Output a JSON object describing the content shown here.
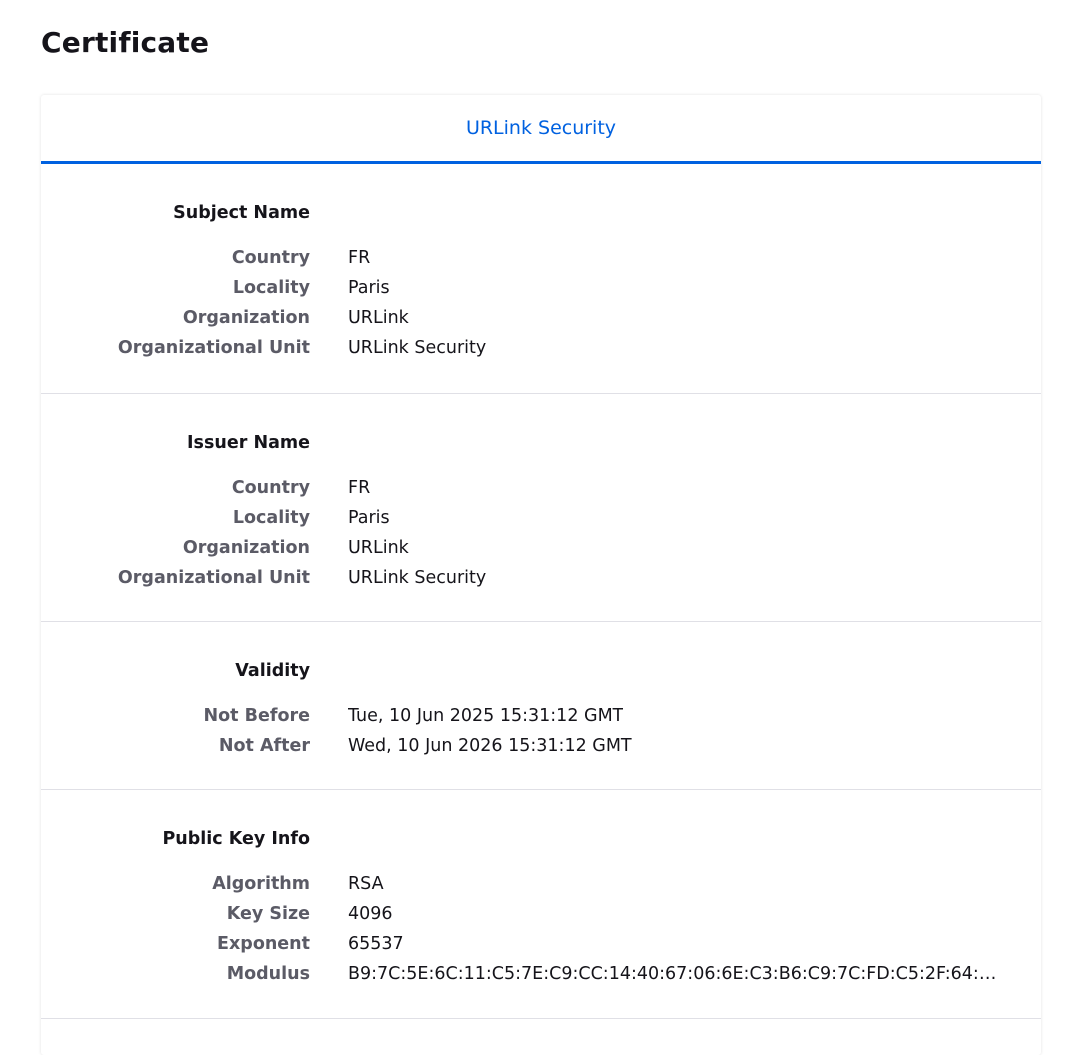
{
  "page": {
    "title": "Certificate"
  },
  "tabs": [
    {
      "label": "URLink Security",
      "active": true
    }
  ],
  "accent_color": "#0061e0",
  "sections": {
    "subject": {
      "heading": "Subject Name",
      "rows": [
        {
          "label": "Country",
          "value": "FR"
        },
        {
          "label": "Locality",
          "value": "Paris"
        },
        {
          "label": "Organization",
          "value": "URLink"
        },
        {
          "label": "Organizational Unit",
          "value": "URLink Security"
        }
      ]
    },
    "issuer": {
      "heading": "Issuer Name",
      "rows": [
        {
          "label": "Country",
          "value": "FR"
        },
        {
          "label": "Locality",
          "value": "Paris"
        },
        {
          "label": "Organization",
          "value": "URLink"
        },
        {
          "label": "Organizational Unit",
          "value": "URLink Security"
        }
      ]
    },
    "validity": {
      "heading": "Validity",
      "rows": [
        {
          "label": "Not Before",
          "value": "Tue, 10 Jun 2025 15:31:12 GMT"
        },
        {
          "label": "Not After",
          "value": "Wed, 10 Jun 2026 15:31:12 GMT"
        }
      ]
    },
    "public_key": {
      "heading": "Public Key Info",
      "rows": [
        {
          "label": "Algorithm",
          "value": "RSA"
        },
        {
          "label": "Key Size",
          "value": "4096"
        },
        {
          "label": "Exponent",
          "value": "65537"
        },
        {
          "label": "Modulus",
          "value": "B9:7C:5E:6C:11:C5:7E:C9:CC:14:40:67:06:6E:C3:B6:C9:7C:FD:C5:2F:64:78:53:..."
        }
      ]
    }
  }
}
